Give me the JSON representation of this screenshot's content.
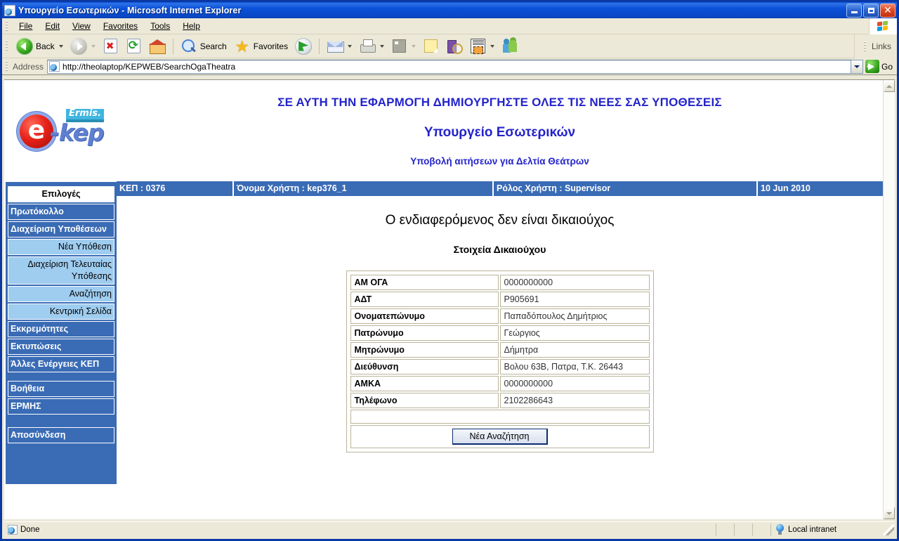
{
  "window": {
    "title": "Υπουργείο Εσωτερικών - Microsoft Internet Explorer",
    "minimize_label": "Minimize",
    "restore_label": "Restore",
    "close_label": "Close"
  },
  "menubar": {
    "items": [
      {
        "label": "File"
      },
      {
        "label": "Edit"
      },
      {
        "label": "View"
      },
      {
        "label": "Favorites"
      },
      {
        "label": "Tools"
      },
      {
        "label": "Help"
      }
    ]
  },
  "toolbar": {
    "back_label": "Back",
    "forward_label": "",
    "search_label": "Search",
    "favorites_label": "Favorites",
    "links_label": "Links",
    "icons": [
      "back-icon",
      "forward-icon",
      "stop-icon",
      "refresh-icon",
      "home-icon",
      "search-icon",
      "favorites-star-icon",
      "media-icon",
      "mail-icon",
      "print-icon",
      "edit-icon",
      "notes-icon",
      "research-icon",
      "screen-capture-icon",
      "messenger-icon"
    ]
  },
  "address_bar": {
    "label": "Address",
    "url": "http://theolaptop/KEPWEB/SearchOgaTheatra",
    "go_label": "Go"
  },
  "sidebar": {
    "logo": {
      "mark_letter": "e",
      "wordmark": "-kep",
      "badge": "Ermis."
    },
    "items": [
      {
        "label": "Επιλογές",
        "type": "head"
      },
      {
        "label": "Πρωτόκολλο",
        "type": "main"
      },
      {
        "label": "Διαχείριση Υποθέσεων",
        "type": "main"
      },
      {
        "label": "Νέα Υπόθεση",
        "type": "sub"
      },
      {
        "label": "Διαχείριση Τελευταίας Υπόθεσης",
        "type": "sub"
      },
      {
        "label": "Αναζήτηση",
        "type": "sub"
      },
      {
        "label": "Κεντρική Σελίδα",
        "type": "sub"
      },
      {
        "label": "Εκκρεμότητες",
        "type": "main"
      },
      {
        "label": "Εκτυπώσεις",
        "type": "main"
      },
      {
        "label": "Άλλες Ενέργειες ΚΕΠ",
        "type": "main"
      },
      {
        "label": "Βοήθεια",
        "type": "main"
      },
      {
        "label": "ΕΡΜΗΣ",
        "type": "main"
      },
      {
        "label": "Αποσύνδεση",
        "type": "main"
      }
    ]
  },
  "banner": {
    "line1": "ΣΕ ΑΥΤΗ ΤΗΝ ΕΦΑΡΜΟΓΗ ΔΗΜΙΟΥΡΓΗΣΤΕ ΟΛΕΣ ΤΙΣ ΝΕΕΣ ΣΑΣ ΥΠΟΘΕΣΕΙΣ",
    "line2": "Υπουργείο Εσωτερικών",
    "line3": "Υποβολή αιτήσεων για Δελτία Θεάτρων"
  },
  "info_bar": {
    "kep": "ΚΕΠ : 0376",
    "username": "Όνομα Χρήστη : kep376_1",
    "role": "Ρόλος Χρήστη : Supervisor",
    "date": "10 Jun 2010"
  },
  "main": {
    "title": "Ο ενδιαφερόμενος δεν είναι δικαιούχος",
    "subtitle": "Στοιχεία Δικαιούχου",
    "rows": [
      {
        "label": "ΑΜ ΟΓΑ",
        "value": "0000000000"
      },
      {
        "label": "ΑΔΤ",
        "value": "Ρ905691"
      },
      {
        "label": "Ονοματεπώνυμο",
        "value": "Παπαδόπουλος Δημήτριος"
      },
      {
        "label": "Πατρώνυμο",
        "value": "Γεώργιος"
      },
      {
        "label": "Μητρώνυμο",
        "value": "Δήμητρα"
      },
      {
        "label": "Διεύθυνση",
        "value": "Βολου 63Β, Πατρα, Τ.Κ. 26443"
      },
      {
        "label": "ΑΜΚΑ",
        "value": "0000000000"
      },
      {
        "label": "Τηλέφωνο",
        "value": "2102286643"
      }
    ],
    "new_search_button": "Νέα Αναζήτηση"
  },
  "status_bar": {
    "text": "Done",
    "zone": "Local intranet"
  },
  "colors": {
    "brand_blue": "#3a6bb5",
    "banner_text": "#2323cc",
    "submenu_bg": "#9fcdf0",
    "titlebar_blue": "#0a50d8",
    "chrome_bg": "#ece9d8"
  }
}
